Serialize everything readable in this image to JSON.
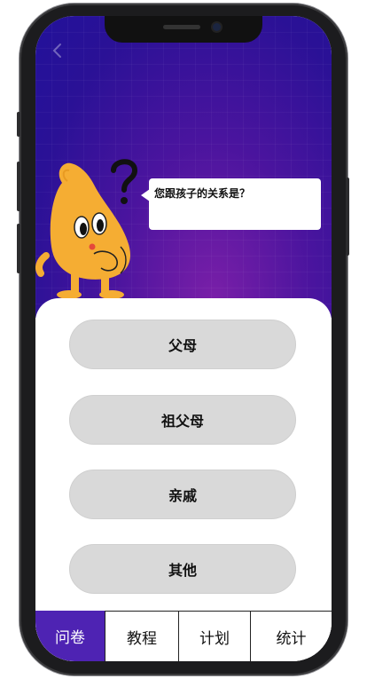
{
  "header": {
    "back_icon": "chevron-left-icon",
    "question": "您跟孩子的关系是？"
  },
  "options": [
    {
      "label": "父母"
    },
    {
      "label": "祖父母"
    },
    {
      "label": "亲戚"
    },
    {
      "label": "其他"
    }
  ],
  "tabs": [
    {
      "label": "问卷",
      "active": true
    },
    {
      "label": "教程",
      "active": false
    },
    {
      "label": "计划",
      "active": false
    },
    {
      "label": "统计",
      "active": false
    }
  ],
  "colors": {
    "hero_top": "#22119a",
    "hero_bottom": "#7a1fa8",
    "mascot": "#f5ad33",
    "option_bg": "#d9d9d9",
    "tab_active": "#4e23b3"
  }
}
